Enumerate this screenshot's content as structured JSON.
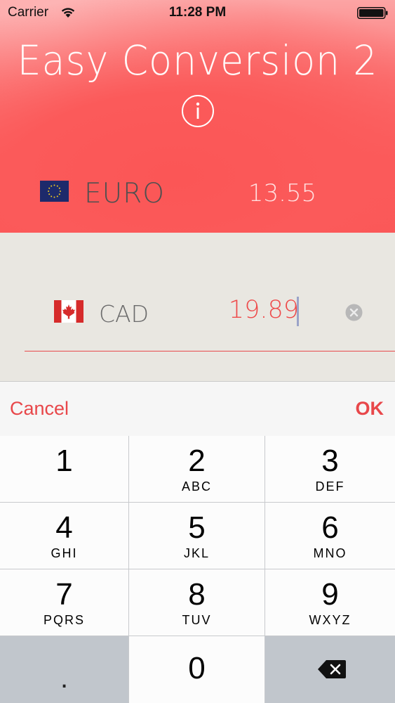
{
  "status_bar": {
    "carrier": "Carrier",
    "time": "11:28 PM"
  },
  "header": {
    "title": "Easy Conversion 2",
    "info_icon": "info-icon"
  },
  "source_currency": {
    "code": "EURO",
    "value": "13.55",
    "flag": "eu-flag-icon"
  },
  "target_currency": {
    "code": "CAD",
    "value": "19.89",
    "flag": "canada-flag-icon",
    "clear_icon": "clear-icon"
  },
  "keyboard_toolbar": {
    "cancel_label": "Cancel",
    "ok_label": "OK"
  },
  "keypad": {
    "keys": [
      {
        "number": "1",
        "letters": ""
      },
      {
        "number": "2",
        "letters": "ABC"
      },
      {
        "number": "3",
        "letters": "DEF"
      },
      {
        "number": "4",
        "letters": "GHI"
      },
      {
        "number": "5",
        "letters": "JKL"
      },
      {
        "number": "6",
        "letters": "MNO"
      },
      {
        "number": "7",
        "letters": "PQRS"
      },
      {
        "number": "8",
        "letters": "TUV"
      },
      {
        "number": "9",
        "letters": "WXYZ"
      }
    ],
    "decimal_label": ".",
    "zero_label": "0",
    "backspace_icon": "backspace-icon"
  },
  "colors": {
    "accent": "#e8474a",
    "header_red": "#fb5a5a",
    "input_bg": "#e9e7e1"
  }
}
